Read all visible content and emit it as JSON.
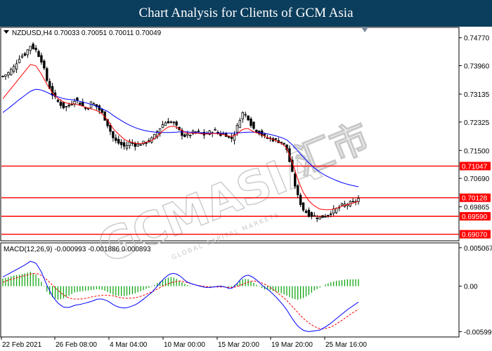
{
  "header": {
    "title": "Chart Analysis for Clients of GCM Asia"
  },
  "main_info": "NZDUSD,H4  0.70033 0.70051 0.70011 0.70049",
  "macd_info": "MACD(12,26,9) -0.000993 -0.001886 0.000893",
  "watermark": {
    "main": "GCMASIA",
    "sub": "GLOBAL CAPITAL MARKETS",
    "cn": "汇市"
  },
  "colors": {
    "header_bg": "#0b3d5c",
    "level_line": "#ff0000",
    "ma_fast": "#ff0000",
    "ma_slow": "#0000ff",
    "histogram": "#00a000",
    "macd_signal": "#ff0000",
    "macd_line": "#0000ff"
  },
  "icons": {
    "menu": "triangle-down-icon",
    "shift": "triangle-marker-icon"
  },
  "chart_data": {
    "type": "candlestick",
    "symbol": "NZDUSD",
    "timeframe": "H4",
    "ylim": [
      0.689,
      0.7505
    ],
    "price_ticks": [
      0.7477,
      0.7396,
      0.73135,
      0.72325,
      0.715,
      0.7069,
      0.69865
    ],
    "levels": [
      {
        "label": "0.71047",
        "value": 0.71047
      },
      {
        "label": "0.70128",
        "value": 0.70128
      },
      {
        "label": "0.69590",
        "value": 0.6959
      },
      {
        "label": "0.69070",
        "value": 0.6907
      }
    ],
    "time_ticks": [
      "22 Feb 2021",
      "26 Feb 08:00",
      "4 Mar 04:00",
      "10 Mar 00:00",
      "15 Mar 20:00",
      "19 Mar 20:00",
      "25 Mar 16:00"
    ],
    "close_path": [
      0.7365,
      0.7375,
      0.7392,
      0.742,
      0.743,
      0.7455,
      0.744,
      0.741,
      0.735,
      0.731,
      0.729,
      0.7275,
      0.728,
      0.73,
      0.7285,
      0.727,
      0.729,
      0.7275,
      0.7255,
      0.722,
      0.718,
      0.717,
      0.716,
      0.7175,
      0.7165,
      0.717,
      0.7175,
      0.7185,
      0.721,
      0.723,
      0.7235,
      0.7225,
      0.72,
      0.719,
      0.72,
      0.7205,
      0.7195,
      0.72,
      0.721,
      0.7195,
      0.72,
      0.718,
      0.721,
      0.726,
      0.725,
      0.7215,
      0.7205,
      0.719,
      0.7185,
      0.718,
      0.7175,
      0.716,
      0.709,
      0.702,
      0.698,
      0.6965,
      0.696,
      0.6955,
      0.696,
      0.697,
      0.698,
      0.699,
      0.6995,
      0.6998,
      0.701
    ],
    "ma_fast": [
      0.73,
      0.732,
      0.734,
      0.736,
      0.738,
      0.74,
      0.7395,
      0.737,
      0.734,
      0.7315,
      0.73,
      0.729,
      0.7285,
      0.7285,
      0.728,
      0.7275,
      0.727,
      0.7265,
      0.7255,
      0.7235,
      0.721,
      0.7195,
      0.718,
      0.7175,
      0.717,
      0.717,
      0.7175,
      0.718,
      0.7195,
      0.721,
      0.722,
      0.722,
      0.721,
      0.72,
      0.72,
      0.72,
      0.7198,
      0.7198,
      0.72,
      0.7198,
      0.7195,
      0.719,
      0.7195,
      0.721,
      0.7215,
      0.7205,
      0.72,
      0.7192,
      0.7185,
      0.718,
      0.7172,
      0.716,
      0.712,
      0.707,
      0.703,
      0.7005,
      0.699,
      0.698,
      0.6978,
      0.6978,
      0.6982,
      0.6988,
      0.6993,
      0.6997,
      0.7003
    ],
    "ma_slow": [
      0.726,
      0.7272,
      0.7285,
      0.7298,
      0.731,
      0.7322,
      0.7328,
      0.7325,
      0.7318,
      0.731,
      0.7305,
      0.73,
      0.7298,
      0.7296,
      0.7292,
      0.7288,
      0.7283,
      0.7278,
      0.727,
      0.7262,
      0.725,
      0.724,
      0.723,
      0.7222,
      0.7215,
      0.721,
      0.7206,
      0.7204,
      0.7202,
      0.7202,
      0.7202,
      0.7203,
      0.7204,
      0.7204,
      0.7203,
      0.7202,
      0.7201,
      0.72,
      0.72,
      0.72,
      0.72,
      0.72,
      0.72,
      0.7202,
      0.7203,
      0.7203,
      0.7202,
      0.72,
      0.7197,
      0.7193,
      0.7188,
      0.7182,
      0.7168,
      0.715,
      0.7132,
      0.7115,
      0.71,
      0.7088,
      0.7078,
      0.707,
      0.7063,
      0.7057,
      0.7052,
      0.7048,
      0.7045
    ],
    "macd_ylim": [
      -0.0066,
      0.0057
    ],
    "macd_ticks": [
      0.005067,
      0.0,
      -0.005998
    ],
    "macd_tick_labels": [
      "0.005067",
      "0.00",
      "-0.005998"
    ],
    "macd_hist": [
      0.001,
      0.0012,
      0.0014,
      0.0015,
      0.0017,
      0.0019,
      0.0015,
      0.0005,
      -0.0008,
      -0.0015,
      -0.0018,
      -0.0016,
      -0.0012,
      -0.0008,
      -0.0007,
      -0.0006,
      -0.0005,
      -0.0004,
      -0.0005,
      -0.0008,
      -0.0012,
      -0.0013,
      -0.0013,
      -0.0011,
      -0.0009,
      -0.0006,
      -0.0003,
      0.0,
      0.0005,
      0.0009,
      0.0012,
      0.0011,
      0.0006,
      0.0002,
      0.0,
      0.0,
      -0.0001,
      -0.0001,
      0.0,
      0.0001,
      0.0,
      -0.0002,
      0.0003,
      0.0009,
      0.001,
      0.0005,
      0.0,
      -0.0004,
      -0.0005,
      -0.0007,
      -0.0009,
      -0.0012,
      -0.0016,
      -0.0018,
      -0.0016,
      -0.0012,
      -0.0006,
      -0.0002,
      0.0002,
      0.0005,
      0.0007,
      0.0008,
      0.0009,
      0.0009,
      0.0009
    ],
    "macd_signal": [
      0.0005,
      0.0008,
      0.001,
      0.0012,
      0.0014,
      0.0016,
      0.0017,
      0.0014,
      0.0008,
      0.0001,
      -0.0006,
      -0.0012,
      -0.0016,
      -0.0017,
      -0.0017,
      -0.0016,
      -0.0014,
      -0.0013,
      -0.0012,
      -0.0012,
      -0.0013,
      -0.0015,
      -0.0016,
      -0.0016,
      -0.0015,
      -0.0013,
      -0.001,
      -0.0007,
      -0.0003,
      0.0001,
      0.0004,
      0.0006,
      0.0007,
      0.0005,
      0.0003,
      0.0001,
      0.0,
      -0.0001,
      -0.0001,
      -0.0001,
      -0.0001,
      -0.0002,
      -0.0001,
      0.0002,
      0.0005,
      0.0007,
      0.0006,
      0.0003,
      -0.0001,
      -0.0006,
      -0.0012,
      -0.0018,
      -0.0026,
      -0.0034,
      -0.0042,
      -0.0048,
      -0.0053,
      -0.0056,
      -0.0056,
      -0.0054,
      -0.005,
      -0.0045,
      -0.004,
      -0.0035,
      -0.003
    ],
    "macd_line": [
      0.0012,
      0.0016,
      0.002,
      0.0024,
      0.0028,
      0.0033,
      0.003,
      0.0018,
      0.0,
      -0.0014,
      -0.0023,
      -0.0028,
      -0.0028,
      -0.0025,
      -0.0024,
      -0.0022,
      -0.002,
      -0.0017,
      -0.0017,
      -0.002,
      -0.0025,
      -0.0028,
      -0.0029,
      -0.0027,
      -0.0024,
      -0.0019,
      -0.0013,
      -0.0007,
      0.0002,
      0.001,
      0.0016,
      0.0017,
      0.0013,
      0.0006,
      0.0003,
      0.0001,
      -0.0001,
      -0.0002,
      -0.0001,
      0.0,
      -0.0001,
      -0.0004,
      0.0002,
      0.0011,
      0.0015,
      0.0012,
      0.0006,
      -0.0001,
      -0.0006,
      -0.0013,
      -0.0021,
      -0.003,
      -0.0042,
      -0.0052,
      -0.0058,
      -0.006,
      -0.0059,
      -0.0058,
      -0.0054,
      -0.0049,
      -0.0043,
      -0.0037,
      -0.0031,
      -0.0026,
      -0.0021
    ]
  }
}
